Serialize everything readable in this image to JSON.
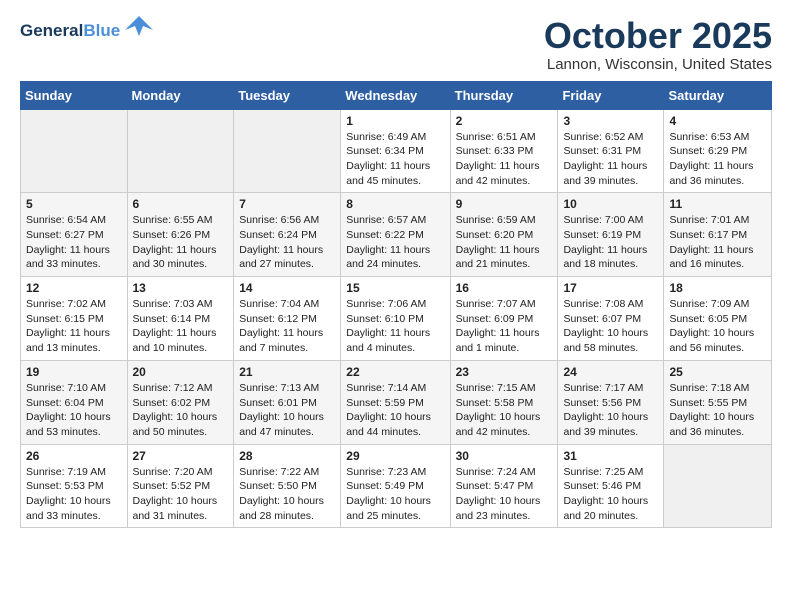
{
  "header": {
    "logo_general": "General",
    "logo_blue": "Blue",
    "month_title": "October 2025",
    "location": "Lannon, Wisconsin, United States"
  },
  "days_of_week": [
    "Sunday",
    "Monday",
    "Tuesday",
    "Wednesday",
    "Thursday",
    "Friday",
    "Saturday"
  ],
  "weeks": [
    [
      {
        "num": "",
        "info": ""
      },
      {
        "num": "",
        "info": ""
      },
      {
        "num": "",
        "info": ""
      },
      {
        "num": "1",
        "info": "Sunrise: 6:49 AM\nSunset: 6:34 PM\nDaylight: 11 hours and 45 minutes."
      },
      {
        "num": "2",
        "info": "Sunrise: 6:51 AM\nSunset: 6:33 PM\nDaylight: 11 hours and 42 minutes."
      },
      {
        "num": "3",
        "info": "Sunrise: 6:52 AM\nSunset: 6:31 PM\nDaylight: 11 hours and 39 minutes."
      },
      {
        "num": "4",
        "info": "Sunrise: 6:53 AM\nSunset: 6:29 PM\nDaylight: 11 hours and 36 minutes."
      }
    ],
    [
      {
        "num": "5",
        "info": "Sunrise: 6:54 AM\nSunset: 6:27 PM\nDaylight: 11 hours and 33 minutes."
      },
      {
        "num": "6",
        "info": "Sunrise: 6:55 AM\nSunset: 6:26 PM\nDaylight: 11 hours and 30 minutes."
      },
      {
        "num": "7",
        "info": "Sunrise: 6:56 AM\nSunset: 6:24 PM\nDaylight: 11 hours and 27 minutes."
      },
      {
        "num": "8",
        "info": "Sunrise: 6:57 AM\nSunset: 6:22 PM\nDaylight: 11 hours and 24 minutes."
      },
      {
        "num": "9",
        "info": "Sunrise: 6:59 AM\nSunset: 6:20 PM\nDaylight: 11 hours and 21 minutes."
      },
      {
        "num": "10",
        "info": "Sunrise: 7:00 AM\nSunset: 6:19 PM\nDaylight: 11 hours and 18 minutes."
      },
      {
        "num": "11",
        "info": "Sunrise: 7:01 AM\nSunset: 6:17 PM\nDaylight: 11 hours and 16 minutes."
      }
    ],
    [
      {
        "num": "12",
        "info": "Sunrise: 7:02 AM\nSunset: 6:15 PM\nDaylight: 11 hours and 13 minutes."
      },
      {
        "num": "13",
        "info": "Sunrise: 7:03 AM\nSunset: 6:14 PM\nDaylight: 11 hours and 10 minutes."
      },
      {
        "num": "14",
        "info": "Sunrise: 7:04 AM\nSunset: 6:12 PM\nDaylight: 11 hours and 7 minutes."
      },
      {
        "num": "15",
        "info": "Sunrise: 7:06 AM\nSunset: 6:10 PM\nDaylight: 11 hours and 4 minutes."
      },
      {
        "num": "16",
        "info": "Sunrise: 7:07 AM\nSunset: 6:09 PM\nDaylight: 11 hours and 1 minute."
      },
      {
        "num": "17",
        "info": "Sunrise: 7:08 AM\nSunset: 6:07 PM\nDaylight: 10 hours and 58 minutes."
      },
      {
        "num": "18",
        "info": "Sunrise: 7:09 AM\nSunset: 6:05 PM\nDaylight: 10 hours and 56 minutes."
      }
    ],
    [
      {
        "num": "19",
        "info": "Sunrise: 7:10 AM\nSunset: 6:04 PM\nDaylight: 10 hours and 53 minutes."
      },
      {
        "num": "20",
        "info": "Sunrise: 7:12 AM\nSunset: 6:02 PM\nDaylight: 10 hours and 50 minutes."
      },
      {
        "num": "21",
        "info": "Sunrise: 7:13 AM\nSunset: 6:01 PM\nDaylight: 10 hours and 47 minutes."
      },
      {
        "num": "22",
        "info": "Sunrise: 7:14 AM\nSunset: 5:59 PM\nDaylight: 10 hours and 44 minutes."
      },
      {
        "num": "23",
        "info": "Sunrise: 7:15 AM\nSunset: 5:58 PM\nDaylight: 10 hours and 42 minutes."
      },
      {
        "num": "24",
        "info": "Sunrise: 7:17 AM\nSunset: 5:56 PM\nDaylight: 10 hours and 39 minutes."
      },
      {
        "num": "25",
        "info": "Sunrise: 7:18 AM\nSunset: 5:55 PM\nDaylight: 10 hours and 36 minutes."
      }
    ],
    [
      {
        "num": "26",
        "info": "Sunrise: 7:19 AM\nSunset: 5:53 PM\nDaylight: 10 hours and 33 minutes."
      },
      {
        "num": "27",
        "info": "Sunrise: 7:20 AM\nSunset: 5:52 PM\nDaylight: 10 hours and 31 minutes."
      },
      {
        "num": "28",
        "info": "Sunrise: 7:22 AM\nSunset: 5:50 PM\nDaylight: 10 hours and 28 minutes."
      },
      {
        "num": "29",
        "info": "Sunrise: 7:23 AM\nSunset: 5:49 PM\nDaylight: 10 hours and 25 minutes."
      },
      {
        "num": "30",
        "info": "Sunrise: 7:24 AM\nSunset: 5:47 PM\nDaylight: 10 hours and 23 minutes."
      },
      {
        "num": "31",
        "info": "Sunrise: 7:25 AM\nSunset: 5:46 PM\nDaylight: 10 hours and 20 minutes."
      },
      {
        "num": "",
        "info": ""
      }
    ]
  ]
}
